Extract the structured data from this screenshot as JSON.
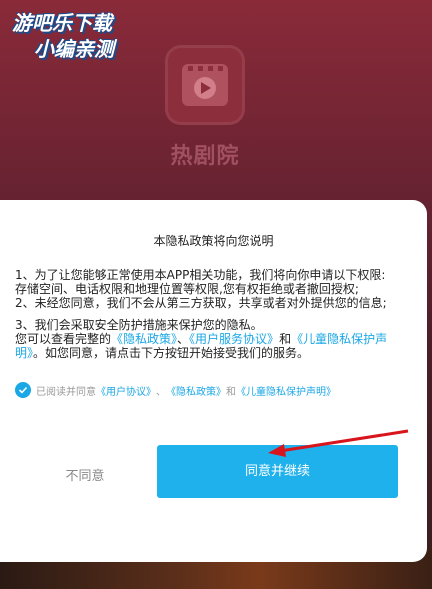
{
  "watermark": {
    "line1": "游吧乐下载",
    "line2": "小编亲测"
  },
  "app": {
    "name": "热剧院"
  },
  "dialog": {
    "title": "本隐私政策将向您说明",
    "para1": "1、为了让您能够正常使用本APP相关功能，我们将向你申请以下权限: 存储空间、电话权限和地理位置等权限,您有权拒绝或者撤回授权;",
    "para2": "2、未经您同意，我们不会从第三方获取，共享或者对外提供您的信息;",
    "para3": "3、我们会采取安全防护措施来保护您的隐私。",
    "para4_prefix": "您可以查看完整的",
    "link_privacy": "《隐私政策》",
    "sep1": "、",
    "link_user_service": "《用户服务协议》",
    "and1": "和",
    "link_child_privacy": "《儿童隐私保护声明》",
    "para4_suffix": "。如您同意，请点击下方按钮开始接受我们的服务。",
    "agree_prefix": "已阅读并同意",
    "agree_link_user": "《用户协议》",
    "agree_sep": "、",
    "agree_link_privacy": "《隐私政策》",
    "agree_and": "和",
    "agree_link_child": "《儿童隐私保护声明》",
    "decline_label": "不同意",
    "accept_label": "同意并继续"
  },
  "colors": {
    "accent": "#1fb1eb",
    "link": "#1aa7e6"
  }
}
